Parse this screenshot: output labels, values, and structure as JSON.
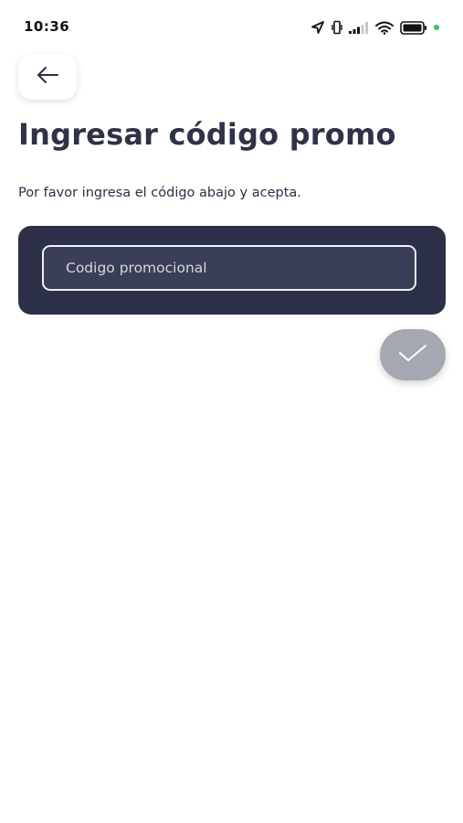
{
  "status_bar": {
    "time": "10:36"
  },
  "icons": {
    "back": "arrow-left-icon",
    "accept": "check-icon",
    "location": "location-arrow-icon",
    "vibrate": "vibrate-icon",
    "signal": "signal-icon",
    "wifi": "wifi-icon",
    "battery": "battery-icon"
  },
  "header": {
    "title": "Ingresar código promo",
    "subtitle": "Por favor ingresa el código abajo y acepta."
  },
  "promo_form": {
    "placeholder": "Codigo promocional",
    "value": ""
  },
  "colors": {
    "card": "#2c3048",
    "title": "#2f3347",
    "accept_button": "#a5a7b1",
    "battery_dot": "#34c759"
  }
}
